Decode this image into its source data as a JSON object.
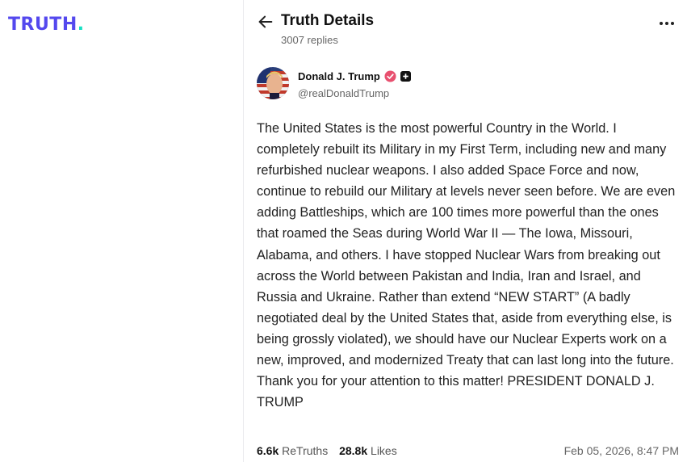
{
  "brand": {
    "logo_text": "TRUTH",
    "logo_dot": ".",
    "primary_color": "#5448ee",
    "accent_color": "#17e0c4"
  },
  "header": {
    "back_icon": "arrow-left-icon",
    "title": "Truth Details",
    "replies": "3007 replies",
    "more_icon": "more-horizontal-icon"
  },
  "author": {
    "name": "Donald J. Trump",
    "handle": "@realDonaldTrump",
    "verified_icon": "verified-badge-icon",
    "verified_color": "#e8506f",
    "plus_icon": "plus-badge-icon"
  },
  "post": {
    "text": "The United States is the most powerful Country in the World. I completely rebuilt its Military in my First Term, including new and many refurbished nuclear weapons. I also added Space Force and now, continue to rebuild our Military at levels never seen before. We are even adding Battleships, which are 100 times more powerful than the ones that roamed the Seas during World War II — The Iowa, Missouri, Alabama, and others. I have stopped Nuclear Wars from breaking out across the World between Pakistan and India, Iran and Israel, and Russia and Ukraine. Rather than extend “NEW START” (A badly negotiated deal by the United States that, aside from everything else, is being grossly violated), we should have our Nuclear Experts work on a new, improved, and modernized Treaty that can last long into the future. Thank you for your attention to this matter! PRESIDENT DONALD J. TRUMP"
  },
  "stats": {
    "retruths_count": "6.6k",
    "retruths_label": "ReTruths",
    "likes_count": "28.8k",
    "likes_label": "Likes",
    "timestamp": "Feb 05, 2026, 8:47 PM"
  }
}
